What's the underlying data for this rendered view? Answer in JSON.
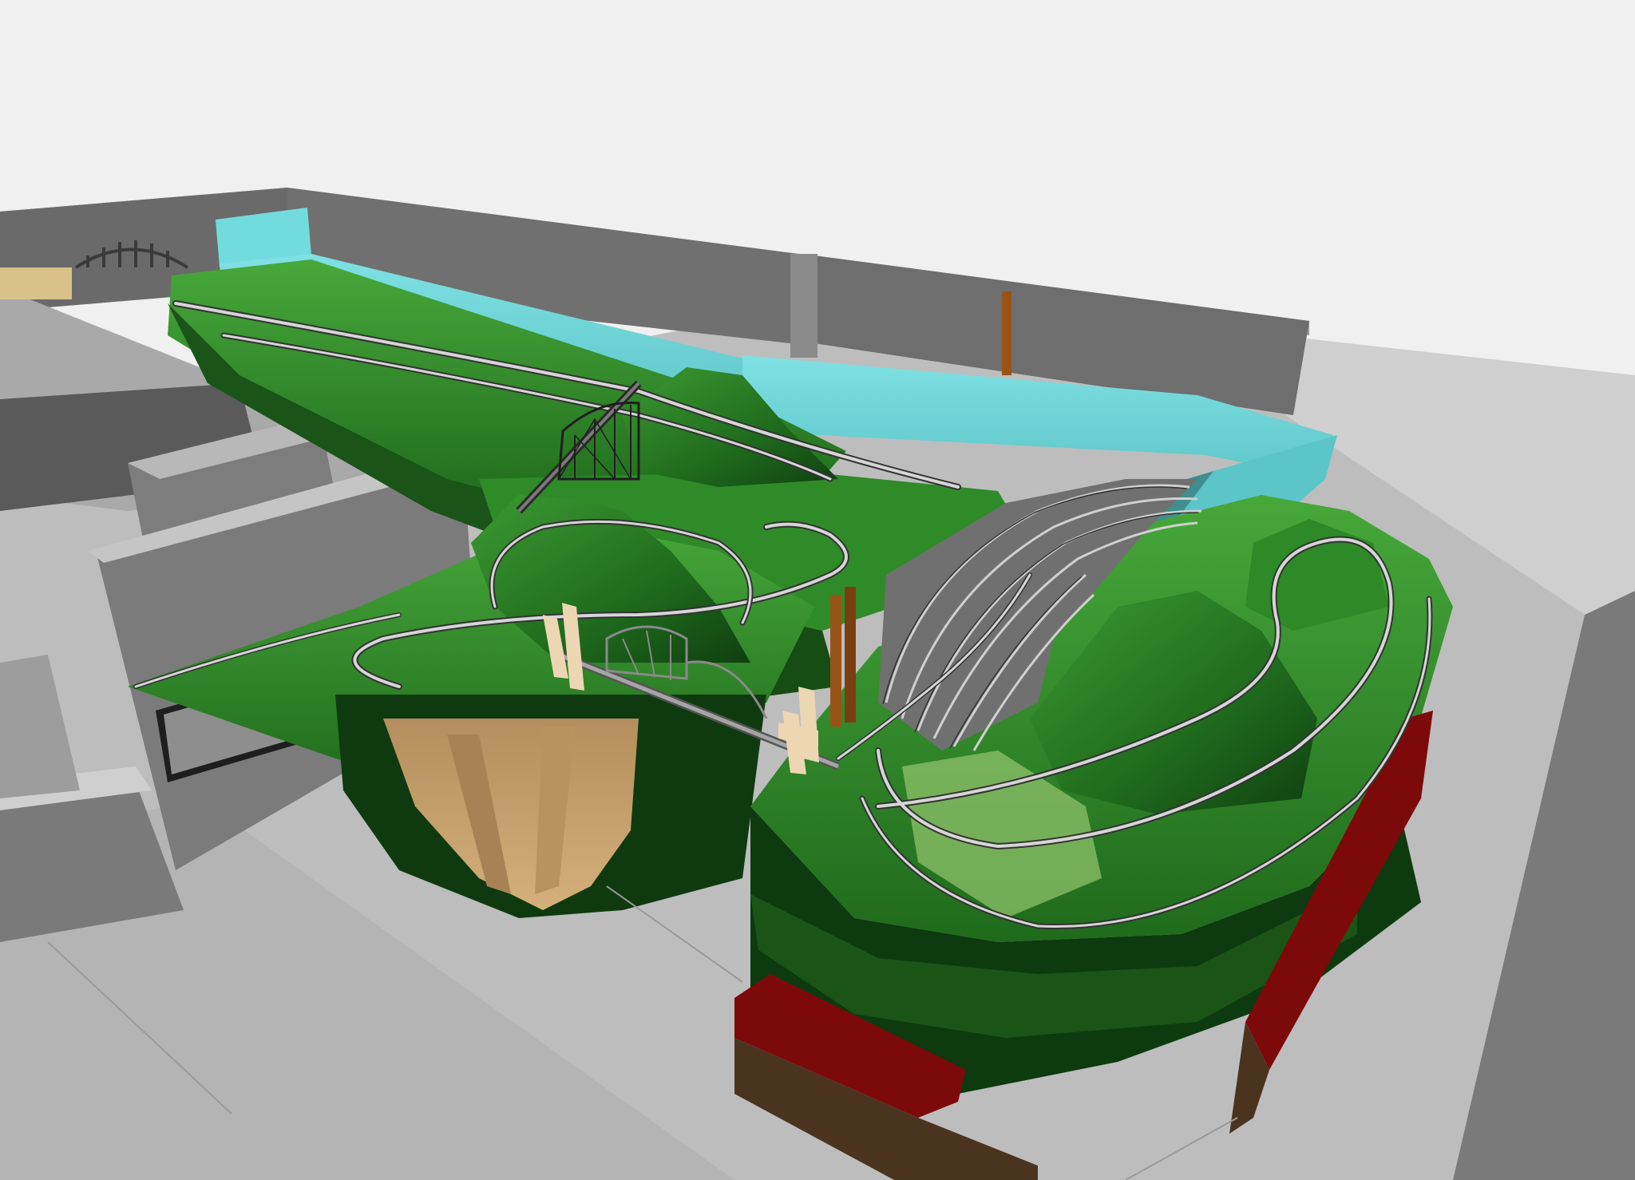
{
  "viewport": {
    "background": "#f0f0f0"
  },
  "palette": {
    "floor": "#bdbdbd",
    "wall_top": "#a8a8a8",
    "wall_face": "#6c6c6c",
    "wall_dark": "#4e4e4e",
    "backdrop": "#6fd6d9",
    "backdrop_shade": "#4fb9bd",
    "terrain_light": "#3fa034",
    "terrain_mid": "#2b7a24",
    "terrain_dark": "#154d14",
    "terrain_shadow": "#0b2a0b",
    "rock": "#c7a06e",
    "track": "#cfcfcf",
    "track_edge": "#3a3a3a",
    "yard_floor": "#6e6e6e",
    "fascia_red": "#7c0a0a",
    "fascia_brown": "#4a3420",
    "pole": "#9a5316",
    "pier": "#ecd7b2",
    "bridge": "#8c8c8c"
  },
  "icons": {
    "viaduct": "arch-bridge-icon",
    "truss": "truss-bridge-icon",
    "trestle": "trestle-bridge-icon"
  }
}
